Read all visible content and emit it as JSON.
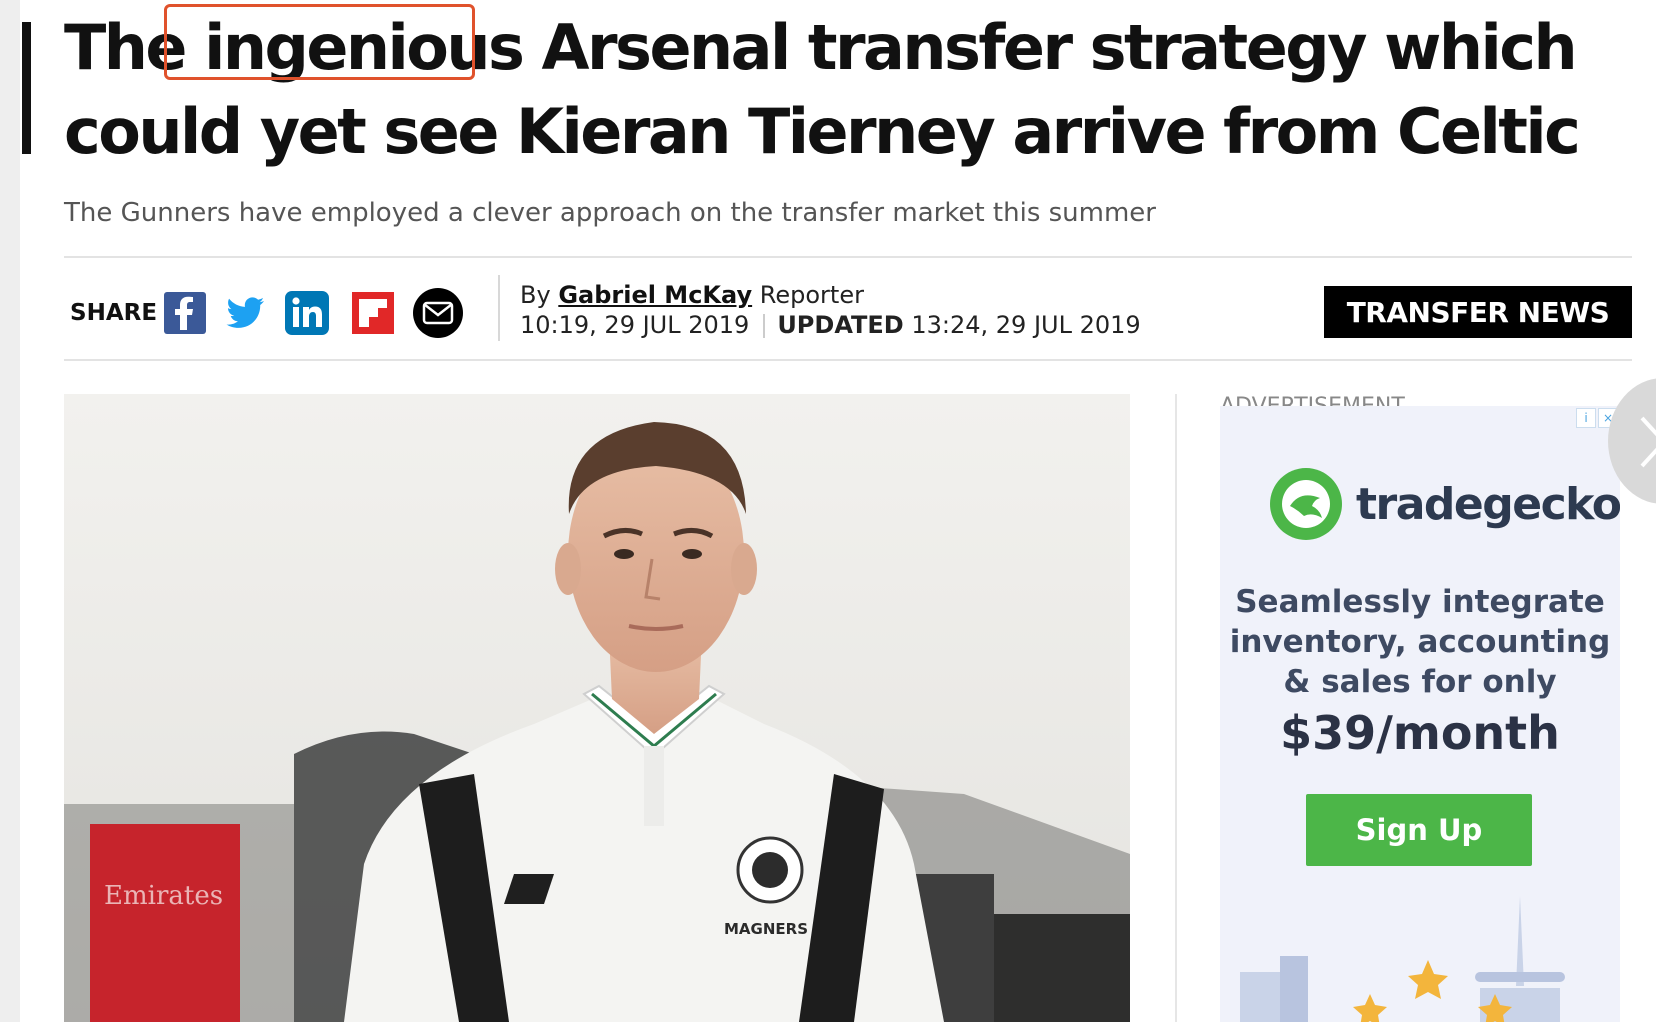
{
  "article": {
    "headline": "The ingenious Arsenal transfer strategy which could yet see Kieran Tierney arrive from Celtic",
    "highlighted_word": "ingenious",
    "standfirst": "The Gunners have employed a clever approach on the transfer market this summer",
    "byline_prefix": "By",
    "author": "Gabriel McKay",
    "role": "Reporter",
    "published": "10:19, 29 JUL 2019",
    "updated_label": "UPDATED",
    "updated": "13:24, 29 JUL 2019",
    "topic_tag": "TRANSFER NEWS"
  },
  "share": {
    "label": "SHARE",
    "buttons": [
      {
        "name": "facebook-icon",
        "color": "#3b5998"
      },
      {
        "name": "twitter-icon",
        "color": "#1da1f2"
      },
      {
        "name": "linkedin-icon",
        "color": "#0077b5"
      },
      {
        "name": "flipboard-icon",
        "color": "#e12828"
      },
      {
        "name": "email-icon",
        "color": "#000000"
      }
    ]
  },
  "photo": {
    "shirt_brand": "MAGNERS",
    "banner_text": "Emirates"
  },
  "advert": {
    "label": "ADVERTISEMENT",
    "brand": "tradegecko",
    "line1": "Seamlessly integrate",
    "line2": "inventory, accounting",
    "line3": "& sales for only",
    "price": "$39/month",
    "cta": "Sign Up",
    "brand_color": "#4cb648"
  }
}
